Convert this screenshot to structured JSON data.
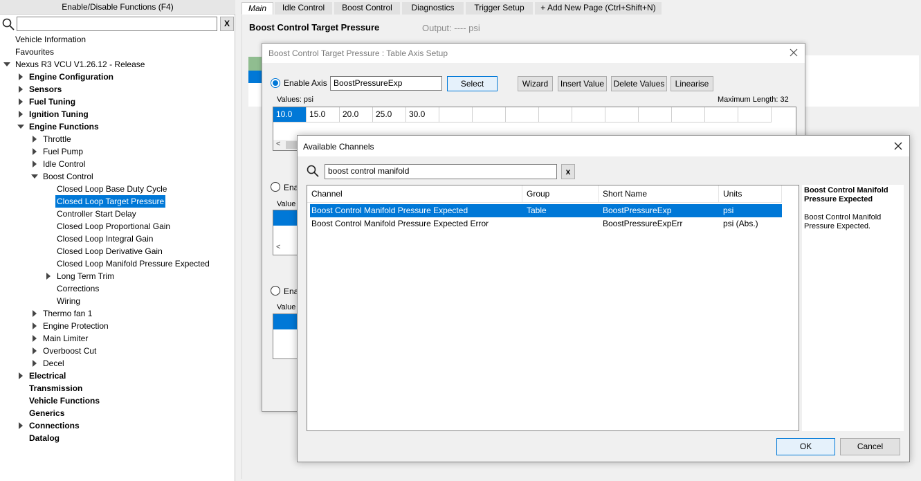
{
  "left": {
    "header": "Enable/Disable Functions (F4)",
    "search_value": "",
    "clear_label": "X",
    "tree": [
      {
        "label": "Vehicle Information",
        "level": 0,
        "arrow": "none",
        "bold": false
      },
      {
        "label": "Favourites",
        "level": 0,
        "arrow": "none",
        "bold": false
      },
      {
        "label": "Nexus R3 VCU V1.26.12 - Release",
        "level": 0,
        "arrow": "down",
        "bold": false
      },
      {
        "label": "Engine Configuration",
        "level": 1,
        "arrow": "right",
        "bold": true
      },
      {
        "label": "Sensors",
        "level": 1,
        "arrow": "right",
        "bold": true
      },
      {
        "label": "Fuel Tuning",
        "level": 1,
        "arrow": "right",
        "bold": true
      },
      {
        "label": "Ignition Tuning",
        "level": 1,
        "arrow": "right",
        "bold": true
      },
      {
        "label": "Engine Functions",
        "level": 1,
        "arrow": "down",
        "bold": true
      },
      {
        "label": "Throttle",
        "level": 2,
        "arrow": "right",
        "bold": false
      },
      {
        "label": "Fuel Pump",
        "level": 2,
        "arrow": "right",
        "bold": false
      },
      {
        "label": "Idle Control",
        "level": 2,
        "arrow": "right",
        "bold": false
      },
      {
        "label": "Boost Control",
        "level": 2,
        "arrow": "down",
        "bold": false
      },
      {
        "label": "Closed Loop Base Duty Cycle",
        "level": 3,
        "arrow": "none",
        "bold": false
      },
      {
        "label": "Closed Loop Target Pressure",
        "level": 3,
        "arrow": "none",
        "bold": false,
        "selected": true
      },
      {
        "label": "Controller Start Delay",
        "level": 3,
        "arrow": "none",
        "bold": false
      },
      {
        "label": "Closed Loop Proportional Gain",
        "level": 3,
        "arrow": "none",
        "bold": false
      },
      {
        "label": "Closed Loop Integral Gain",
        "level": 3,
        "arrow": "none",
        "bold": false
      },
      {
        "label": "Closed Loop Derivative Gain",
        "level": 3,
        "arrow": "none",
        "bold": false
      },
      {
        "label": "Closed Loop Manifold Pressure Expected",
        "level": 3,
        "arrow": "none",
        "bold": false
      },
      {
        "label": "Long Term Trim",
        "level": 3,
        "arrow": "right",
        "bold": false
      },
      {
        "label": "Corrections",
        "level": 3,
        "arrow": "none",
        "bold": false
      },
      {
        "label": "Wiring",
        "level": 3,
        "arrow": "none",
        "bold": false
      },
      {
        "label": "Thermo fan 1",
        "level": 2,
        "arrow": "right",
        "bold": false
      },
      {
        "label": "Engine Protection",
        "level": 2,
        "arrow": "right",
        "bold": false
      },
      {
        "label": "Main Limiter",
        "level": 2,
        "arrow": "right",
        "bold": false
      },
      {
        "label": "Overboost Cut",
        "level": 2,
        "arrow": "right",
        "bold": false
      },
      {
        "label": "Decel",
        "level": 2,
        "arrow": "right",
        "bold": false
      },
      {
        "label": "Electrical",
        "level": 1,
        "arrow": "right",
        "bold": true
      },
      {
        "label": "Transmission",
        "level": 1,
        "arrow": "none",
        "bold": true
      },
      {
        "label": "Vehicle Functions",
        "level": 1,
        "arrow": "none",
        "bold": true
      },
      {
        "label": "Generics",
        "level": 1,
        "arrow": "none",
        "bold": true
      },
      {
        "label": "Connections",
        "level": 1,
        "arrow": "right",
        "bold": true
      },
      {
        "label": "Datalog",
        "level": 1,
        "arrow": "none",
        "bold": true
      }
    ]
  },
  "tabs": [
    {
      "label": "Main",
      "active": true
    },
    {
      "label": "Idle Control",
      "active": false
    },
    {
      "label": "Boost Control",
      "active": false
    },
    {
      "label": "Diagnostics",
      "active": false
    },
    {
      "label": "Trigger Setup",
      "active": false
    },
    {
      "label": "+ Add New Page (Ctrl+Shift+N)",
      "active": false
    }
  ],
  "page": {
    "title": "Boost Control Target Pressure",
    "output": "Output: ---- psi"
  },
  "axis_dialog": {
    "title": "Boost Control Target Pressure : Table Axis Setup",
    "enable_axis_label": "Enable Axis",
    "enable_axis_short": "Ena",
    "axis_channel": "BoostPressureExp",
    "select_label": "Select",
    "wizard_label": "Wizard",
    "insert_label": "Insert Value",
    "delete_label": "Delete Values",
    "linearise_label": "Linearise",
    "values_label": "Values: psi",
    "values_short": "Value",
    "max_length": "Maximum Length: 32",
    "values": [
      "10.0",
      "15.0",
      "20.0",
      "25.0",
      "30.0"
    ],
    "empty_cells": 10,
    "scroll_left": "<"
  },
  "channels_dialog": {
    "title": "Available Channels",
    "search_value": "boost control manifold",
    "clear_label": "x",
    "columns": [
      "Channel",
      "Group",
      "Short Name",
      "Units"
    ],
    "rows": [
      {
        "channel": "Boost Control Manifold Pressure Expected",
        "group": "Table",
        "short": "BoostPressureExp",
        "units": "psi",
        "selected": true
      },
      {
        "channel": "Boost Control Manifold Pressure Expected Error",
        "group": "",
        "short": "BoostPressureExpErr",
        "units": "psi (Abs.)",
        "selected": false
      }
    ],
    "desc_title": "Boost Control Manifold Pressure Expected",
    "desc_body": "Boost Control Manifold Pressure Expected.",
    "ok_label": "OK",
    "cancel_label": "Cancel"
  },
  "colors": {
    "selection": "#0078d7",
    "panel": "#f0f0f0",
    "accent_green": "#90bd90"
  }
}
